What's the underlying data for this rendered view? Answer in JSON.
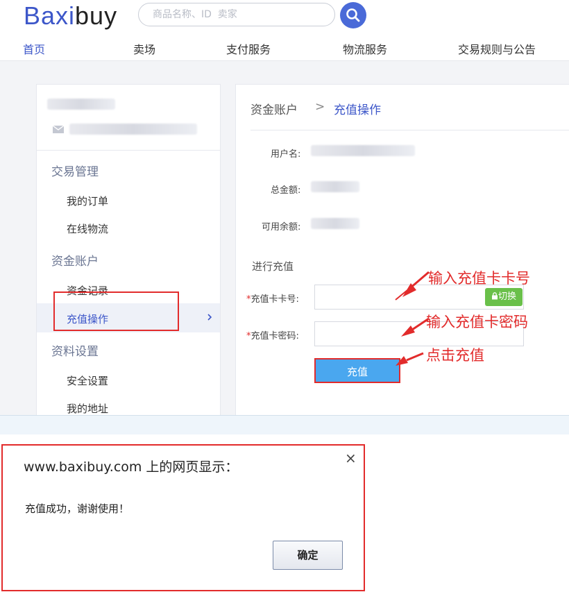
{
  "header": {
    "logo_main": "Baxi",
    "logo_tail": "buy",
    "search_placeholder": "商品名称、ID  卖家"
  },
  "nav": [
    {
      "label": "首页",
      "active": true
    },
    {
      "label": "卖场"
    },
    {
      "label": "支付服务"
    },
    {
      "label": "物流服务"
    },
    {
      "label": "交易规则与公告"
    }
  ],
  "sidebar": {
    "group1_title": "交易管理",
    "group1_items": [
      "我的订单",
      "在线物流"
    ],
    "group2_title": "资金账户",
    "group2_items": [
      "资金记录",
      "充值操作"
    ],
    "group3_title": "资料设置",
    "group3_items": [
      "安全设置",
      "我的地址"
    ],
    "active_item": "充值操作"
  },
  "breadcrumb": {
    "parent": "资金账户",
    "separator": ">",
    "current": "充值操作"
  },
  "account": {
    "username_label": "用户名:",
    "total_label": "总金额:",
    "available_label": "可用余额:"
  },
  "recharge": {
    "section_title": "进行充值",
    "card_number_label": "充值卡卡号:",
    "card_password_label": "充值卡密码:",
    "required_mark": "*",
    "switch_label": "切换",
    "submit_label": "充值"
  },
  "annotations": {
    "card_number": "输入充值卡卡号",
    "card_password": "输入充值卡密码",
    "click_submit": "点击充值"
  },
  "dialog": {
    "title": "www.baxibuy.com 上的网页显示：",
    "message": "充值成功，谢谢使用！",
    "ok_label": "确定",
    "close_symbol": "×"
  },
  "colors": {
    "brand": "#3d57c9",
    "annotation_red": "#e22b2b",
    "submit_blue": "#4aa7ef",
    "switch_green": "#6ac04a"
  }
}
